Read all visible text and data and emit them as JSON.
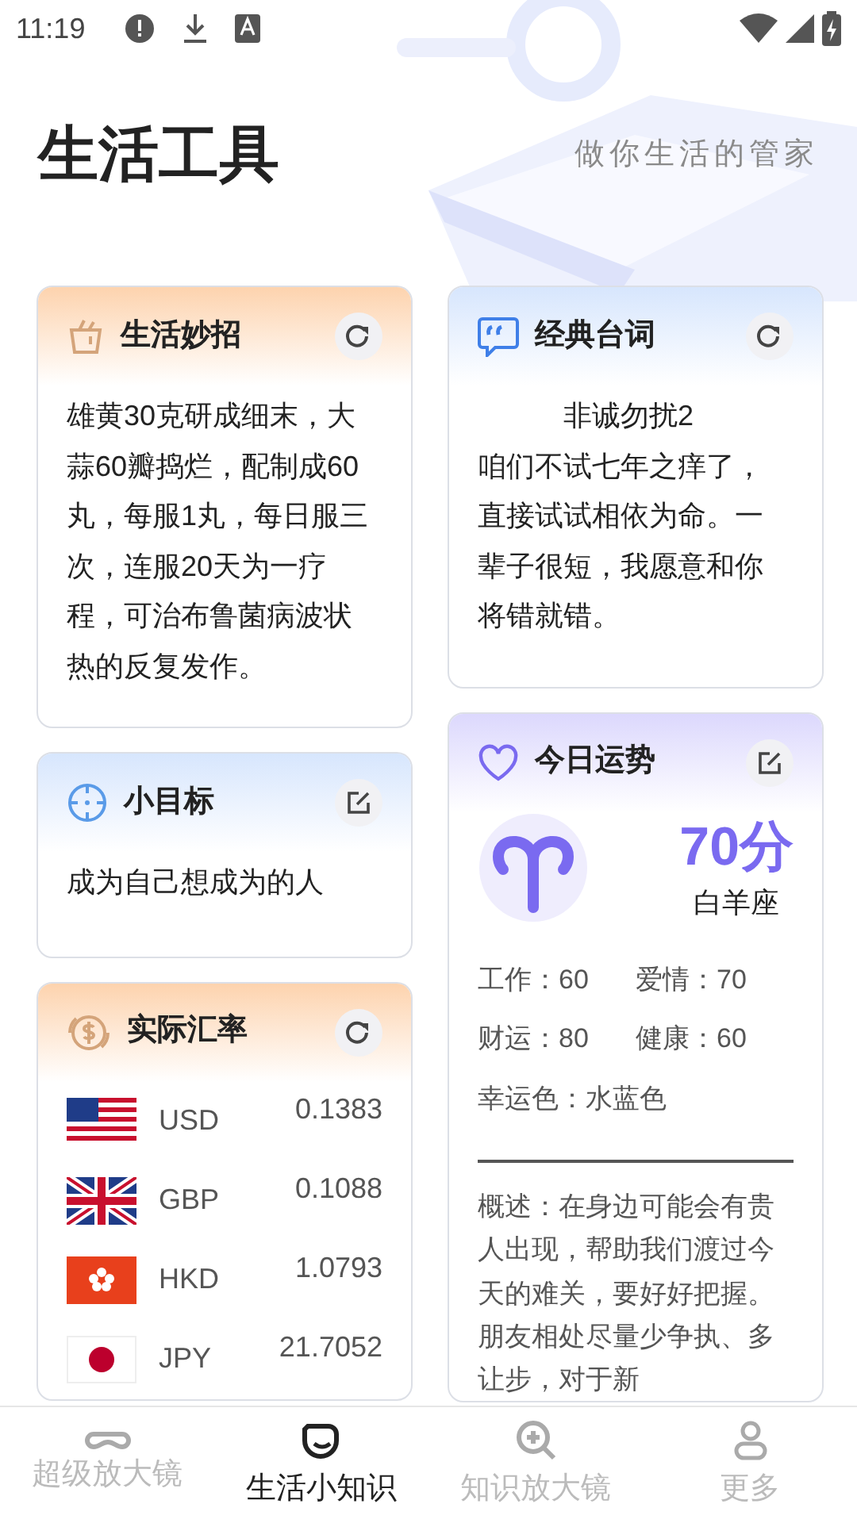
{
  "status_bar": {
    "time": "11:19"
  },
  "header": {
    "title": "生活工具",
    "subtitle": "做你生活的管家"
  },
  "tips": {
    "title": "生活妙招",
    "text": "雄黄30克研成细末，大蒜60瓣捣烂，配制成60丸，每服1丸，每日服三次，连服20天为一疗程，可治布鲁菌病波状热的反复发作。"
  },
  "goal": {
    "title": "小目标",
    "text": "成为自己想成为的人"
  },
  "exchange_rates": {
    "title": "实际汇率",
    "rows": [
      {
        "code": "USD",
        "rate": "0.1383"
      },
      {
        "code": "GBP",
        "rate": "0.1088"
      },
      {
        "code": "HKD",
        "rate": "1.0793"
      },
      {
        "code": "JPY",
        "rate": "21.7052"
      }
    ]
  },
  "quote": {
    "title": "经典台词",
    "movie": "非诚勿扰2",
    "text": "咱们不试七年之痒了，直接试试相依为命。一辈子很短，我愿意和你将错就错。"
  },
  "fortune": {
    "title": "今日运势",
    "score": "70分",
    "sign": "白羊座",
    "stats": [
      "工作：60",
      "爱情：70",
      "财运：80",
      "健康：60"
    ],
    "lucky_color": "幸运色：水蓝色",
    "summary": "概述：在身边可能会有贵人出现，帮助我们渡过今天的难关，要好好把握。朋友相处尽量少争执、多让步，对于新"
  },
  "tabs": [
    {
      "label": "超级放大镜",
      "selected": false
    },
    {
      "label": "生活小知识",
      "selected": true
    },
    {
      "label": "知识放大镜",
      "selected": false
    },
    {
      "label": "更多",
      "selected": false
    }
  ]
}
